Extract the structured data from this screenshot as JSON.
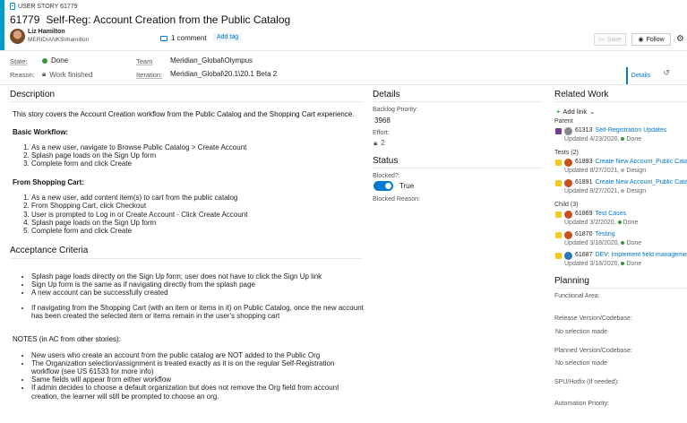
{
  "header": {
    "type_label": "USER STORY 61779",
    "id": "61779",
    "title": "Self-Reg: Account Creation from the Public Catalog",
    "user_name": "Liz Hamilton",
    "user_handle": "MERIDIANKS\\lhamilton",
    "comment_count": "1 comment",
    "add_tag": "Add tag",
    "save": "Save",
    "follow": "Follow",
    "gear": "⚙"
  },
  "fields": {
    "state_label": "State:",
    "state_value": "Done",
    "reason_label": "Reason:",
    "reason_value": "Work finished",
    "team_label": "Team",
    "team_value": "Meridian_Global\\Olympus",
    "iteration_label": "Iteration:",
    "iteration_value": "Meridian_Global\\20.1\\20.1 Beta 2"
  },
  "tabs": {
    "details": "Details"
  },
  "colors": {
    "accent": "#009ccc",
    "done": "#339933",
    "design": "#b2b2b2",
    "link": "#0078d4"
  },
  "description": {
    "heading": "Description",
    "intro": "This story covers the Account Creation workflow from the Public Catalog and the Shopping Cart experience.",
    "basic_heading": "Basic Workflow:",
    "basic_steps": [
      "As a new user, navigate to Browse Public Catalog > Create Account",
      "Splash page loads on the Sign Up form",
      "Complete form and click Create"
    ],
    "cart_heading": "From Shopping Cart:",
    "cart_steps": [
      "As a new user, add content item(s) to cart from the public catalog",
      "From Shopping Cart, click Checkout",
      "User is prompted to Log in or Create Account - Click Create Account",
      "Splash page loads on the Sign Up form",
      "Complete form and click Create"
    ]
  },
  "acceptance": {
    "heading": "Acceptance Criteria",
    "list1": [
      "Splash page loads directly on the Sign Up form; user does not have to click the Sign Up link",
      "Sign Up form is the same as if navigating directly from the splash page",
      "A new account can be successfully created"
    ],
    "list2": [
      "If navigating from the Shopping Cart (with an item or items in it) on Public Catalog, once the new account has been created the selected item or items remain in the user's shopping cart"
    ],
    "notes_heading": "NOTES (in AC from other stories):",
    "notes": [
      "New users who create an account from the public catalog are NOT added to the Public Org",
      "The Organization selection/assignment is treated exactly as it is on the regular Self-Registration workflow (see US 61533 for more info)",
      "Same fields will appear from either workflow",
      "If admin decides to choose a default organization but does not remove the Org field from account creation, the learner will still be prompted to choose an org."
    ]
  },
  "details": {
    "heading": "Details",
    "backlog_label": "Backlog Priority:",
    "backlog_value": "3968",
    "effort_label": "Effort:",
    "effort_value": "2",
    "status_heading": "Status",
    "blocked_label": "Blocked?:",
    "blocked_value": "True",
    "blocked_reason_label": "Blocked Reason:"
  },
  "related": {
    "heading": "Related Work",
    "add_link": "Add link",
    "parent_label": "Parent",
    "parent": {
      "id": "61313",
      "title": "Self-Registration Updates",
      "updated": "Updated 4/23/2020,",
      "state": "Done"
    },
    "tests_label": "Tests (2)",
    "tests": [
      {
        "id": "61893",
        "title": "Create New Account_Public Catalog",
        "updated": "Updated 8/27/2021,",
        "state": "Design"
      },
      {
        "id": "61891",
        "title": "Create New Account_Public Catalog",
        "updated": "Updated 8/27/2021,",
        "state": "Design"
      }
    ],
    "child_label": "Child (3)",
    "children": [
      {
        "id": "61869",
        "title": "Test Cases",
        "updated": "Updated 3/2/2020,",
        "state": "Done"
      },
      {
        "id": "61870",
        "title": "Testing",
        "updated": "Updated 3/18/2020,",
        "state": "Done"
      },
      {
        "id": "61687",
        "title": "DEV: Implement field management",
        "updated": "Updated 3/18/2020,",
        "state": "Done"
      }
    ]
  },
  "planning": {
    "heading": "Planning",
    "functional_label": "Functional Area:",
    "release_label": "Release Version/Codebase:",
    "release_value": "No selection made",
    "planned_label": "Planned Version/Codebase:",
    "planned_value": "No selection made",
    "spu_label": "SPU/Hotfix (If needed):",
    "automation_label": "Automation Priority:"
  }
}
